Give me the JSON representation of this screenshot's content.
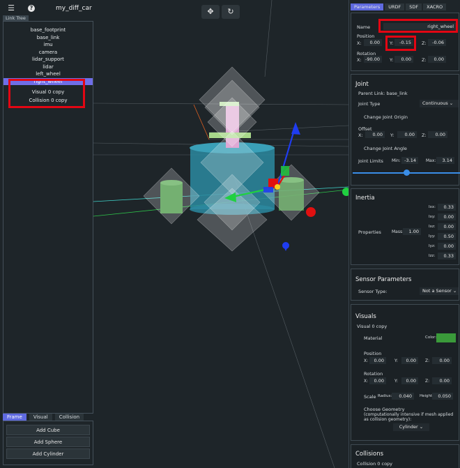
{
  "app": {
    "title": "my_diff_car"
  },
  "topbar": {
    "menu_icon": "hamburger-icon",
    "help_icon": "help-icon",
    "help_glyph": "?",
    "tools": [
      "move-icon",
      "rotate-icon"
    ]
  },
  "link_tree": {
    "tab_label": "Link Tree",
    "items": [
      "base_footprint",
      "base_link",
      "imu",
      "camera",
      "lidar_support",
      "lidar",
      "left_wheel",
      "right_wheel"
    ],
    "selected": "right_wheel",
    "sub_items": [
      "Visual 0 copy",
      "Collision 0 copy"
    ]
  },
  "bottom_panel": {
    "tabs": [
      "Frame",
      "Visual",
      "Collision"
    ],
    "active_tab": "Frame",
    "buttons": [
      "Add Cube",
      "Add Sphere",
      "Add Cylinder"
    ]
  },
  "right_panel": {
    "tabs": [
      "Parameters",
      "URDF",
      "SDF",
      "XACRO"
    ],
    "active_tab": "Parameters",
    "name_label": "Name",
    "name_value": "right_wheel",
    "position_label": "Position",
    "position": {
      "x": "0.00",
      "y": "-0.15",
      "z": "-0.06"
    },
    "rotation_label": "Rotation",
    "rotation": {
      "x": "-90.00",
      "y": "0.00",
      "z": "0.00"
    },
    "axis_labels": {
      "x": "X:",
      "y": "Y:",
      "z": "Z:"
    },
    "joint": {
      "title": "Joint",
      "parent_link": "Parent Link: base_link",
      "joint_type_label": "Joint Type",
      "joint_type_value": "Continuous",
      "change_origin": "Change Joint Origin",
      "offset_label": "Offset",
      "offset": {
        "x": "0.00",
        "y": "0.00",
        "z": "0.00"
      },
      "change_angle": "Change Joint Angle",
      "limits_label": "Joint Limits",
      "min_label": "Min:",
      "min_value": "-3.14",
      "max_label": "Max:",
      "max_value": "3.14",
      "slider_fraction": 0.5
    },
    "inertia": {
      "title": "Inertia",
      "properties_label": "Properties",
      "mass_label": "Mass:",
      "mass_value": "1.00",
      "tensor": [
        {
          "label": "Ixx:",
          "value": "0.33"
        },
        {
          "label": "Ixy:",
          "value": "0.00"
        },
        {
          "label": "Ixz:",
          "value": "0.00"
        },
        {
          "label": "Iyy:",
          "value": "0.50"
        },
        {
          "label": "Iyz:",
          "value": "0.00"
        },
        {
          "label": "Izz:",
          "value": "0.33"
        }
      ]
    },
    "sensor": {
      "title": "Sensor Parameters",
      "type_label": "Sensor Type:",
      "type_value": "Not a Sensor"
    },
    "visuals": {
      "title": "Visuals",
      "item_name": "Visual 0 copy",
      "material_label": "Material",
      "color_label": "Color:",
      "color_hex": "#3a9a3a",
      "position_label": "Position",
      "position": {
        "x": "0.00",
        "y": "0.00",
        "z": "0.00"
      },
      "rotation_label": "Rotation",
      "rotation": {
        "x": "0.00",
        "y": "0.00",
        "z": "0.00"
      },
      "scale_label": "Scale",
      "radius_label": "Radius:",
      "radius_value": "0.040",
      "height_label": "Height:",
      "height_value": "0.050",
      "geometry_label": "Choose Geometry",
      "geometry_note": "(computationally intensive if mesh applied as collision geometry):",
      "geometry_value": "Cylinder"
    },
    "collisions": {
      "title": "Collisions",
      "item_name": "Collision 0 copy"
    }
  },
  "colors": {
    "accent": "#5f6ae0",
    "highlight": "#e30613",
    "background": "#1e2529"
  }
}
